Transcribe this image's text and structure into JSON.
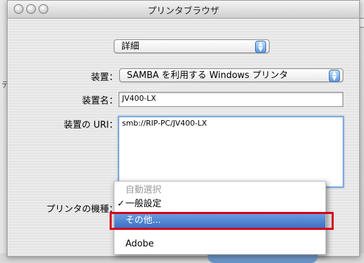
{
  "window": {
    "title": "プリンタブラウザ"
  },
  "background": {
    "left_text": "デ"
  },
  "top_popup": {
    "value": "詳細"
  },
  "device": {
    "label": "装置：",
    "value": "SAMBA を利用する Windows プリンタ"
  },
  "device_name": {
    "label": "装置名：",
    "value": "JV400-LX"
  },
  "device_uri": {
    "label": "装置の URI：",
    "value": "smb://RIP-PC/JV400-LX"
  },
  "printer_model": {
    "label": "プリンタの機種："
  },
  "menu": {
    "items": [
      {
        "label": "自動選択",
        "disabled": true
      },
      {
        "label": "一般設定",
        "checked": true
      },
      {
        "label": "その他...",
        "selected": true
      },
      {
        "label": "Adobe"
      }
    ],
    "check_mark": "✓"
  },
  "colors": {
    "highlight": "#d3001a",
    "selection": "#3a6fc4"
  }
}
